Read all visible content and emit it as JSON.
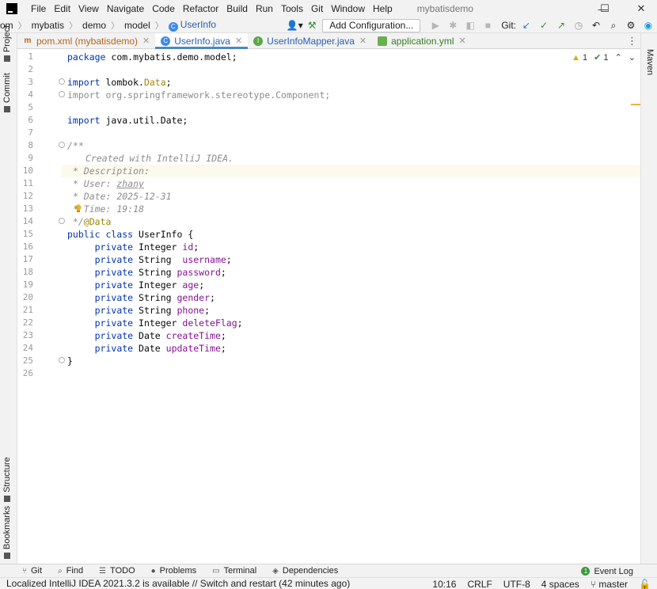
{
  "menubar": {
    "items": [
      "File",
      "Edit",
      "View",
      "Navigate",
      "Code",
      "Refactor",
      "Build",
      "Run",
      "Tools",
      "Git",
      "Window",
      "Help"
    ],
    "project_title": "mybatisdemo"
  },
  "window_controls": {
    "minimize": "—",
    "maximize": "☐",
    "close": "✕"
  },
  "breadcrumb": {
    "items": [
      "om",
      "mybatis",
      "demo",
      "model",
      "UserInfo"
    ]
  },
  "nav_tools": {
    "add_configuration": "Add Configuration...",
    "git_label": "Git:"
  },
  "editor_tabs": [
    {
      "label": "pom.xml (mybatisdemo)",
      "icon": "maven-icon",
      "active": false
    },
    {
      "label": "UserInfo.java",
      "icon": "class-icon",
      "active": true
    },
    {
      "label": "UserInfoMapper.java",
      "icon": "interface-icon",
      "active": false
    },
    {
      "label": "application.yml",
      "icon": "yaml-icon",
      "active": false
    }
  ],
  "left_tools": [
    "Project",
    "Commit",
    "Structure",
    "Bookmarks"
  ],
  "right_tools": [
    "Maven"
  ],
  "inspections": {
    "warnings": "1",
    "weak_warnings": "1"
  },
  "code": {
    "line_numbers": [
      "1",
      "2",
      "3",
      "4",
      "5",
      "6",
      "7",
      "8",
      "9",
      "10",
      "11",
      "12",
      "13",
      "14",
      "15",
      "16",
      "17",
      "18",
      "19",
      "20",
      "21",
      "22",
      "23",
      "24",
      "25",
      "26"
    ],
    "package_kw": "package",
    "package_name": "com.mybatis.demo.model;",
    "import_kw": "import",
    "import1_a": "lombok.",
    "import1_b": "Data",
    "import1_c": ";",
    "import2": "import org.springframework.stereotype.Component;",
    "import3": "java.util.Date;",
    "c1": "/**",
    "c2": "Created with IntelliJ IDEA.",
    "c3": "* Description:",
    "c4_a": "* User: ",
    "c4_b": "zhany",
    "c5": "* Date: 2025-12-31",
    "c6": "* Time: 19:18",
    "c7": " */",
    "c7_anno": "@Data",
    "class_kw": "public class",
    "class_name": " UserInfo {",
    "private_kw": "private",
    "fields": [
      {
        "type": " Integer ",
        "name": "id",
        "end": ";"
      },
      {
        "type": " String  ",
        "name": "username",
        "end": ";"
      },
      {
        "type": " String ",
        "name": "password",
        "end": ";"
      },
      {
        "type": " Integer ",
        "name": "age",
        "end": ";"
      },
      {
        "type": " String ",
        "name": "gender",
        "end": ";"
      },
      {
        "type": " String ",
        "name": "phone",
        "end": ";"
      },
      {
        "type": " Integer ",
        "name": "deleteFlag",
        "end": ";"
      },
      {
        "type": " Date ",
        "name": "createTime",
        "end": ";"
      },
      {
        "type": " Date ",
        "name": "updateTime",
        "end": ";"
      }
    ],
    "close_brace": "}"
  },
  "tool_windows": [
    {
      "label": "Git",
      "icon": "git-branch-icon"
    },
    {
      "label": "Find",
      "icon": "search-icon"
    },
    {
      "label": "TODO",
      "icon": "list-icon"
    },
    {
      "label": "Problems",
      "icon": "warning-circle-icon"
    },
    {
      "label": "Terminal",
      "icon": "terminal-icon"
    },
    {
      "label": "Dependencies",
      "icon": "stack-icon"
    }
  ],
  "event_log": "Event Log",
  "event_log_count": "1",
  "status": {
    "message": "Localized IntelliJ IDEA 2021.3.2 is available // Switch and restart (42 minutes ago)",
    "position": "10:16",
    "line_separator": "CRLF",
    "encoding": "UTF-8",
    "indent": "4 spaces",
    "branch": "master"
  }
}
